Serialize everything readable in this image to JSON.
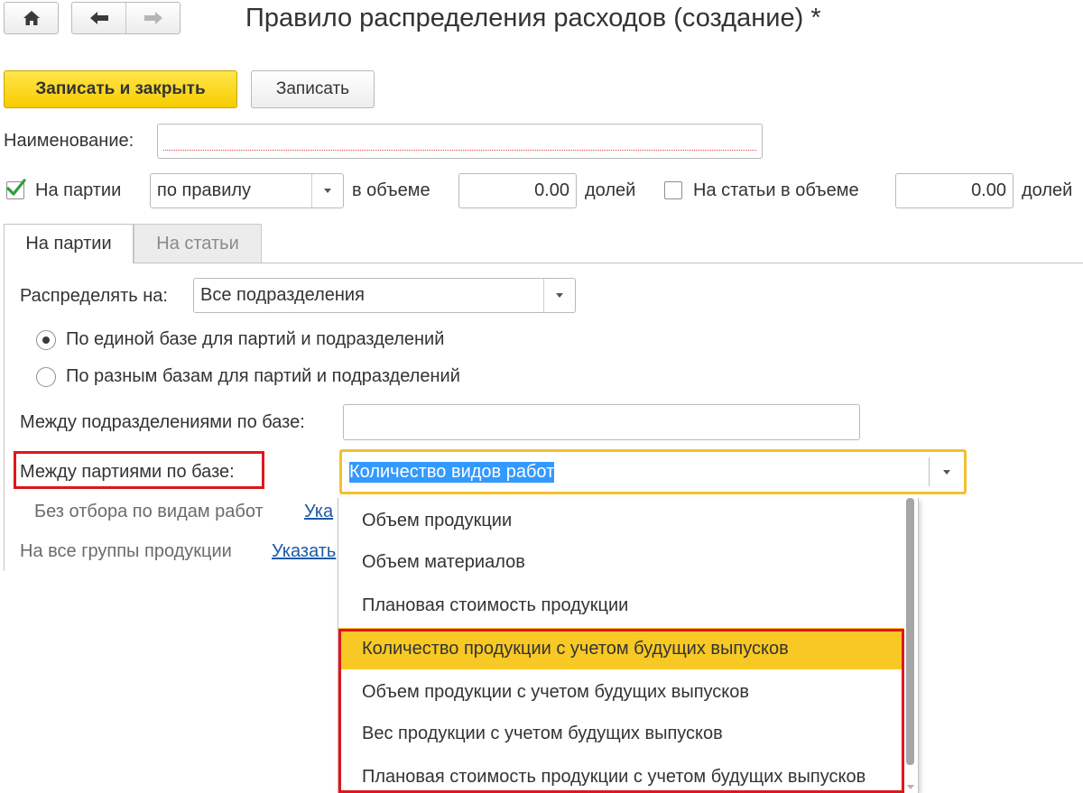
{
  "window": {
    "title": "Правило распределения расходов (создание) *"
  },
  "toolbar": {
    "save_close_label": "Записать и закрыть",
    "save_label": "Записать"
  },
  "name_field": {
    "label": "Наименование:",
    "value": ""
  },
  "batch_row": {
    "checkbox_label": "На партии",
    "checked": true,
    "mode_value": "по правилу",
    "volume_label": "в объеме",
    "volume_value": "0.00",
    "units_label": "долей",
    "items_checkbox_label": "На статьи в объеме",
    "items_checked": false,
    "items_volume_value": "0.00",
    "items_units_label": "долей"
  },
  "tabs": [
    {
      "label": "На партии",
      "active": true
    },
    {
      "label": "На статьи",
      "active": false
    }
  ],
  "distribute": {
    "label": "Распределять на:",
    "value": "Все подразделения"
  },
  "radios": [
    {
      "label": "По единой базе для партий и подразделений",
      "selected": true
    },
    {
      "label": "По разным базам для партий и подразделений",
      "selected": false
    }
  ],
  "between_departments": {
    "label": "Между подразделениями по базе:",
    "value": ""
  },
  "between_batches": {
    "label": "Между партиями по базе:",
    "value": "Количество видов работ",
    "options": [
      "Объем продукции",
      "Объем материалов",
      "Плановая стоимость продукции",
      "Количество продукции с учетом будущих выпусков",
      "Объем продукции с учетом будущих выпусков",
      "Вес продукции с учетом будущих выпусков",
      "Плановая стоимость продукции с учетом будущих выпусков"
    ],
    "highlighted_option": 3
  },
  "filters": [
    {
      "label": "Без отбора по видам работ",
      "link": "Ука"
    },
    {
      "label": "На все группы продукции",
      "link": "Указать"
    }
  ],
  "colors": {
    "accent_yellow": "#f6cc00",
    "selection_yellow": "#f8c824",
    "annotation_red": "#e0161c",
    "focus_border": "#f2c02e",
    "text_selection": "#3399ff",
    "check_green": "#2e9e3e",
    "link_blue": "#1c5aa5"
  },
  "icons": {
    "home": "home-icon",
    "back": "arrow-left-icon",
    "forward": "arrow-right-icon",
    "check": "checkmark-icon",
    "dropdown": "chevron-down-icon"
  }
}
